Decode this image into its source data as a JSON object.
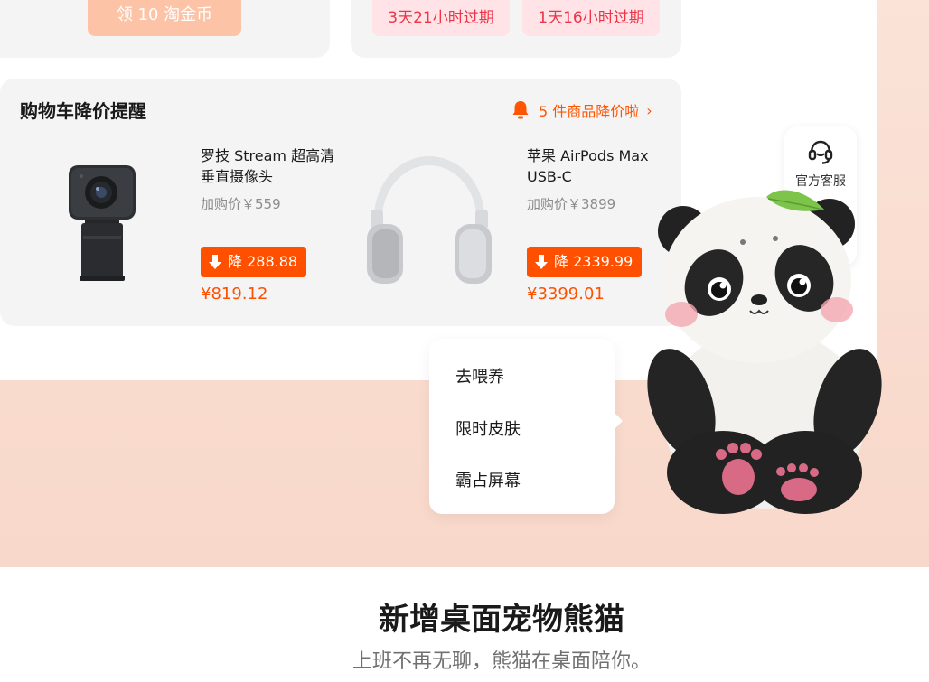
{
  "top": {
    "claim_button": "领 10 淘金币",
    "coupons": [
      "3天21小时过期",
      "1天16小时过期"
    ]
  },
  "cart_alert": {
    "title": "购物车降价提醒",
    "alert_text": "5 件商品降价啦",
    "chevron": "›",
    "products": [
      {
        "name": "罗技 Stream 超高清垂直摄像头",
        "added_price": "加购价￥559",
        "drop": "降 288.88",
        "price": "¥819.12",
        "image": "webcam-image"
      },
      {
        "name": "苹果 AirPods Max USB-C",
        "added_price": "加购价￥3899",
        "drop": "降 2339.99",
        "price": "¥3399.01",
        "image": "headphones-image"
      }
    ]
  },
  "service": {
    "label": "官方客服",
    "icon": "headset-icon"
  },
  "pet_menu": {
    "items": [
      "去喂养",
      "限时皮肤",
      "霸占屏幕"
    ]
  },
  "promo": {
    "headline": "新增桌面宠物熊猫",
    "subline": "上班不再无聊，熊猫在桌面陪你。"
  },
  "colors": {
    "accent": "#ff5000",
    "coupon_text": "#ef3448",
    "peach_bg": "#f9dccf"
  }
}
